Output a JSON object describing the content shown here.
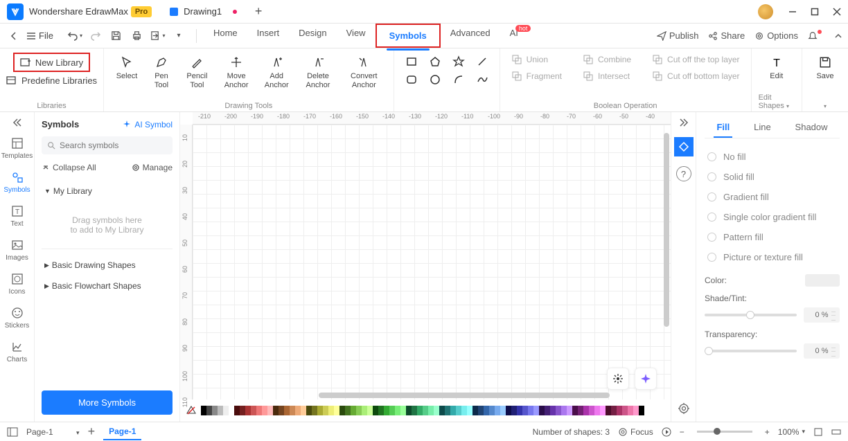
{
  "titlebar": {
    "app_name": "Wondershare EdrawMax",
    "pro": "Pro",
    "tab_name": "Drawing1"
  },
  "menubar": {
    "file": "File",
    "items": [
      "Home",
      "Insert",
      "Design",
      "View",
      "Symbols",
      "Advanced",
      "AI"
    ],
    "hot": "hot",
    "publish": "Publish",
    "share": "Share",
    "options": "Options"
  },
  "ribbon": {
    "new_library": "New Library",
    "predefine_libraries": "Predefine Libraries",
    "libraries_label": "Libraries",
    "select": "Select",
    "pen_tool": "Pen Tool",
    "pencil_tool": "Pencil Tool",
    "move_anchor": "Move Anchor",
    "add_anchor": "Add Anchor",
    "delete_anchor": "Delete Anchor",
    "convert_anchor": "Convert Anchor",
    "drawing_tools_label": "Drawing Tools",
    "union": "Union",
    "combine": "Combine",
    "cut_top": "Cut off the top layer",
    "fragment": "Fragment",
    "intersect": "Intersect",
    "cut_bottom": "Cut off bottom layer",
    "boolean_label": "Boolean Operation",
    "edit_shapes": "Edit Shapes",
    "edit": "Edit",
    "save": "Save"
  },
  "sidebar": {
    "templates": "Templates",
    "symbols": "Symbols",
    "text": "Text",
    "images": "Images",
    "icons": "Icons",
    "stickers": "Stickers",
    "charts": "Charts"
  },
  "symbol_panel": {
    "title": "Symbols",
    "ai_symbol": "AI Symbol",
    "search_placeholder": "Search symbols",
    "collapse_all": "Collapse All",
    "manage": "Manage",
    "my_library": "My Library",
    "dropzone_l1": "Drag symbols here",
    "dropzone_l2": "to add to My Library",
    "basic_drawing": "Basic Drawing Shapes",
    "basic_flowchart": "Basic Flowchart Shapes",
    "more_symbols": "More Symbols"
  },
  "ruler_h": [
    "-210",
    "-200",
    "-190",
    "-180",
    "-170",
    "-160",
    "-150",
    "-140",
    "-130",
    "-120",
    "-110",
    "-100",
    "-90",
    "-80",
    "-70",
    "-60",
    "-50",
    "-40"
  ],
  "ruler_v": [
    "10",
    "20",
    "30",
    "40",
    "50",
    "60",
    "70",
    "80",
    "90",
    "100",
    "110"
  ],
  "prop": {
    "tabs": [
      "Fill",
      "Line",
      "Shadow"
    ],
    "no_fill": "No fill",
    "solid_fill": "Solid fill",
    "gradient_fill": "Gradient fill",
    "single_gradient": "Single color gradient fill",
    "pattern_fill": "Pattern fill",
    "picture_fill": "Picture or texture fill",
    "color": "Color:",
    "shade_tint": "Shade/Tint:",
    "transparency": "Transparency:",
    "shade_val": "0 %",
    "trans_val": "0 %"
  },
  "status": {
    "page_sel": "Page-1",
    "page_tab": "Page-1",
    "shapes": "Number of shapes: 3",
    "focus": "Focus",
    "zoom": "100% "
  },
  "colors": [
    "#000",
    "#444",
    "#888",
    "#bbb",
    "#eee",
    "#fff",
    "#4a0d0d",
    "#742020",
    "#a33",
    "#c55",
    "#e77",
    "#f99",
    "#fbb",
    "#4a2a0d",
    "#744420",
    "#a63",
    "#c85",
    "#ea7",
    "#fc9",
    "#4a4a0d",
    "#747420",
    "#aa3",
    "#cc5",
    "#ee7",
    "#ff9",
    "#2a4a0d",
    "#447420",
    "#6a3",
    "#8c5",
    "#ae7",
    "#cf9",
    "#0d4a0d",
    "#207420",
    "#3a3",
    "#5c5",
    "#7e7",
    "#9f9",
    "#0d4a2a",
    "#207444",
    "#3a6",
    "#5c8",
    "#7ea",
    "#9fc",
    "#0d4a4a",
    "#207474",
    "#3aa",
    "#5cc",
    "#7ee",
    "#9ff",
    "#0d2a4a",
    "#204474",
    "#36a",
    "#58c",
    "#7ae",
    "#9cf",
    "#0d0d4a",
    "#202074",
    "#33a",
    "#55c",
    "#77e",
    "#99f",
    "#2a0d4a",
    "#442074",
    "#63a",
    "#85c",
    "#a7e",
    "#c9f",
    "#4a0d4a",
    "#742074",
    "#a3a",
    "#c5c",
    "#e7e",
    "#f9f",
    "#4a0d2a",
    "#742044",
    "#a36",
    "#c58",
    "#e7a",
    "#f9c",
    "#000"
  ]
}
